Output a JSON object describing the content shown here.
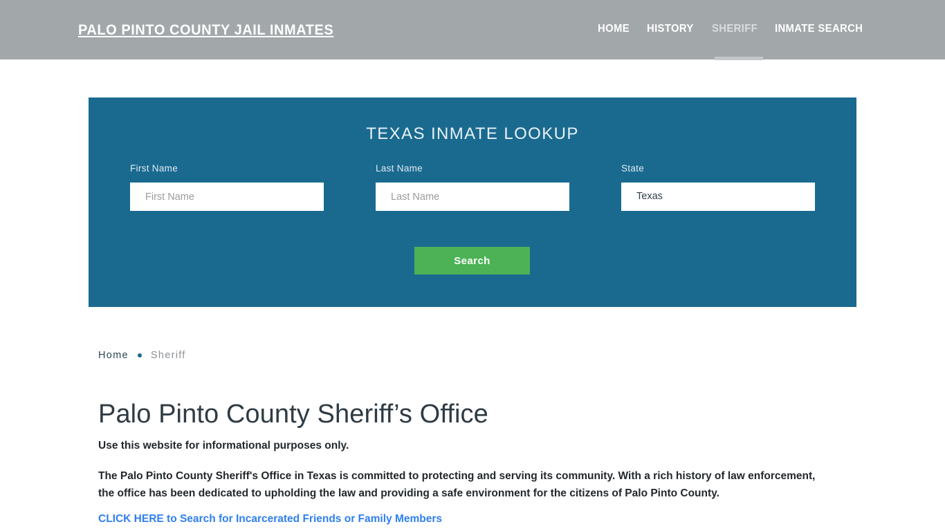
{
  "header": {
    "brand": "PALO PINTO COUNTY JAIL INMATES",
    "nav": [
      {
        "label": "HOME",
        "active": false
      },
      {
        "label": "HISTORY",
        "active": false
      },
      {
        "label": "SHERIFF",
        "active": true
      },
      {
        "label": "INMATE SEARCH",
        "active": false
      }
    ],
    "bg_color": "#a2a7aa",
    "active_underline_color": "#c3c7c9"
  },
  "lookup": {
    "title": "TEXAS INMATE LOOKUP",
    "panel_color": "#1a6a90",
    "first_name": {
      "label": "First Name",
      "placeholder": "First Name",
      "value": ""
    },
    "last_name": {
      "label": "Last Name",
      "placeholder": "Last Name",
      "value": ""
    },
    "state": {
      "label": "State",
      "value": "Texas",
      "options": [
        "Texas"
      ]
    },
    "search_button": {
      "label": "Search",
      "color": "#4cb255"
    }
  },
  "breadcrumb": {
    "home": "Home",
    "separator": "•",
    "current": "Sheriff"
  },
  "main": {
    "title": "Palo Pinto County Sheriff’s Office",
    "lede": "Use this website for informational purposes only.",
    "paragraph": "The Palo Pinto County Sheriff's Office in Texas is committed to protecting and serving its community. With a rich history of law enforcement, the office has been dedicated to upholding the law and providing a safe environment for the citizens of Palo Pinto County.",
    "cta_link": "CLICK HERE to Search for Incarcerated Friends or Family Members",
    "cta_link_color": "#2f7ff0"
  }
}
